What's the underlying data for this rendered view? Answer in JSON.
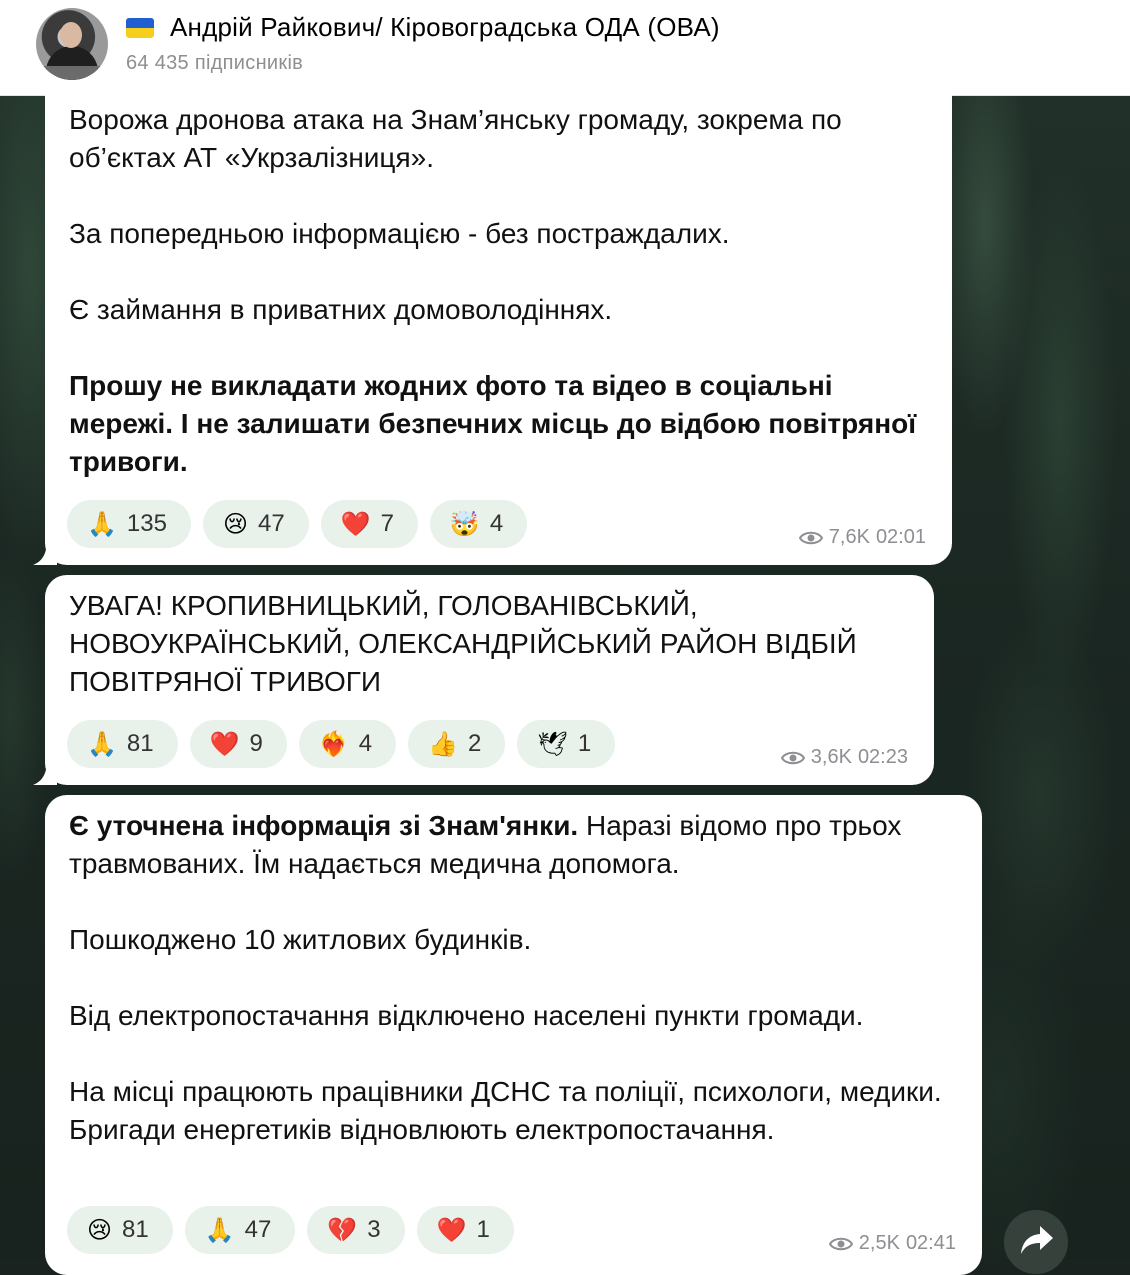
{
  "channel": {
    "flag": "🇺🇦",
    "title": "Андрій Райкович/ Кіровоградська ОДА (ОВА)",
    "subscribers": "64 435 підписників"
  },
  "messages": [
    {
      "paragraphs": [
        "Ворожа дронова атака на Знам’янську громаду, зокрема по об’єктах АТ «Укрзалізниця».",
        "За попередньою інформацією - без постраждалих.",
        "Є займання в приватних домоволодіннях.",
        "Прошу не викладати жодних фото та відео в соціальні мережі. І не залишати безпечних місць до відбою повітряної тривоги."
      ],
      "reactions": [
        {
          "emoji": "🙏",
          "count": "135"
        },
        {
          "emoji": "😢",
          "count": "47"
        },
        {
          "emoji": "❤️",
          "count": "7"
        },
        {
          "emoji": "🤯",
          "count": "4"
        }
      ],
      "views": "7,6K",
      "time": "02:01"
    },
    {
      "paragraphs": [
        "УВАГА! КРОПИВНИЦЬКИЙ, ГОЛОВАНІВСЬКИЙ, НОВОУКРАЇНСЬКИЙ, ОЛЕКСАНДРІЙСЬКИЙ РАЙОН ВІДБІЙ ПОВІТРЯНОЇ ТРИВОГИ"
      ],
      "reactions": [
        {
          "emoji": "🙏",
          "count": "81"
        },
        {
          "emoji": "❤️",
          "count": "9"
        },
        {
          "emoji": "❤️‍🔥",
          "count": "4"
        },
        {
          "emoji": "👍",
          "count": "2"
        },
        {
          "emoji": "🕊",
          "count": "1"
        }
      ],
      "views": "3,6K",
      "time": "02:23"
    },
    {
      "lead_bold": "Є уточнена інформація зі Знам'янки.",
      "lead_rest": " Наразі відомо про трьох травмованих. Їм надається медична допомога.",
      "paragraphs": [
        "Пошкоджено 10 житлових будинків.",
        "Від електропостачання відключено  населені пункти громади.",
        "На місці працюють працівники ДСНС та поліції, психологи, медики. Бригади енергетиків відновлюють електропостачання."
      ],
      "reactions": [
        {
          "emoji": "😢",
          "count": "81"
        },
        {
          "emoji": "🙏",
          "count": "47"
        },
        {
          "emoji": "💔",
          "count": "3"
        },
        {
          "emoji": "❤️",
          "count": "1"
        }
      ],
      "views": "2,5K",
      "time": "02:41"
    }
  ]
}
